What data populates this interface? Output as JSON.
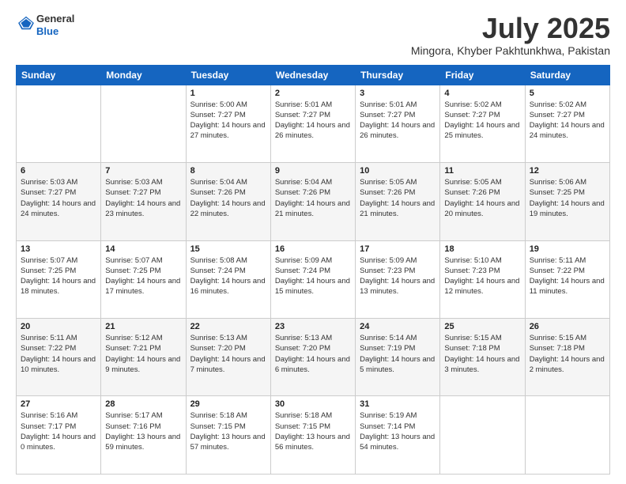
{
  "header": {
    "logo_general": "General",
    "logo_blue": "Blue",
    "month_title": "July 2025",
    "location": "Mingora, Khyber Pakhtunkhwa, Pakistan"
  },
  "weekdays": [
    "Sunday",
    "Monday",
    "Tuesday",
    "Wednesday",
    "Thursday",
    "Friday",
    "Saturday"
  ],
  "weeks": [
    [
      {
        "day": "",
        "sunrise": "",
        "sunset": "",
        "daylight": ""
      },
      {
        "day": "",
        "sunrise": "",
        "sunset": "",
        "daylight": ""
      },
      {
        "day": "1",
        "sunrise": "Sunrise: 5:00 AM",
        "sunset": "Sunset: 7:27 PM",
        "daylight": "Daylight: 14 hours and 27 minutes."
      },
      {
        "day": "2",
        "sunrise": "Sunrise: 5:01 AM",
        "sunset": "Sunset: 7:27 PM",
        "daylight": "Daylight: 14 hours and 26 minutes."
      },
      {
        "day": "3",
        "sunrise": "Sunrise: 5:01 AM",
        "sunset": "Sunset: 7:27 PM",
        "daylight": "Daylight: 14 hours and 26 minutes."
      },
      {
        "day": "4",
        "sunrise": "Sunrise: 5:02 AM",
        "sunset": "Sunset: 7:27 PM",
        "daylight": "Daylight: 14 hours and 25 minutes."
      },
      {
        "day": "5",
        "sunrise": "Sunrise: 5:02 AM",
        "sunset": "Sunset: 7:27 PM",
        "daylight": "Daylight: 14 hours and 24 minutes."
      }
    ],
    [
      {
        "day": "6",
        "sunrise": "Sunrise: 5:03 AM",
        "sunset": "Sunset: 7:27 PM",
        "daylight": "Daylight: 14 hours and 24 minutes."
      },
      {
        "day": "7",
        "sunrise": "Sunrise: 5:03 AM",
        "sunset": "Sunset: 7:27 PM",
        "daylight": "Daylight: 14 hours and 23 minutes."
      },
      {
        "day": "8",
        "sunrise": "Sunrise: 5:04 AM",
        "sunset": "Sunset: 7:26 PM",
        "daylight": "Daylight: 14 hours and 22 minutes."
      },
      {
        "day": "9",
        "sunrise": "Sunrise: 5:04 AM",
        "sunset": "Sunset: 7:26 PM",
        "daylight": "Daylight: 14 hours and 21 minutes."
      },
      {
        "day": "10",
        "sunrise": "Sunrise: 5:05 AM",
        "sunset": "Sunset: 7:26 PM",
        "daylight": "Daylight: 14 hours and 21 minutes."
      },
      {
        "day": "11",
        "sunrise": "Sunrise: 5:05 AM",
        "sunset": "Sunset: 7:26 PM",
        "daylight": "Daylight: 14 hours and 20 minutes."
      },
      {
        "day": "12",
        "sunrise": "Sunrise: 5:06 AM",
        "sunset": "Sunset: 7:25 PM",
        "daylight": "Daylight: 14 hours and 19 minutes."
      }
    ],
    [
      {
        "day": "13",
        "sunrise": "Sunrise: 5:07 AM",
        "sunset": "Sunset: 7:25 PM",
        "daylight": "Daylight: 14 hours and 18 minutes."
      },
      {
        "day": "14",
        "sunrise": "Sunrise: 5:07 AM",
        "sunset": "Sunset: 7:25 PM",
        "daylight": "Daylight: 14 hours and 17 minutes."
      },
      {
        "day": "15",
        "sunrise": "Sunrise: 5:08 AM",
        "sunset": "Sunset: 7:24 PM",
        "daylight": "Daylight: 14 hours and 16 minutes."
      },
      {
        "day": "16",
        "sunrise": "Sunrise: 5:09 AM",
        "sunset": "Sunset: 7:24 PM",
        "daylight": "Daylight: 14 hours and 15 minutes."
      },
      {
        "day": "17",
        "sunrise": "Sunrise: 5:09 AM",
        "sunset": "Sunset: 7:23 PM",
        "daylight": "Daylight: 14 hours and 13 minutes."
      },
      {
        "day": "18",
        "sunrise": "Sunrise: 5:10 AM",
        "sunset": "Sunset: 7:23 PM",
        "daylight": "Daylight: 14 hours and 12 minutes."
      },
      {
        "day": "19",
        "sunrise": "Sunrise: 5:11 AM",
        "sunset": "Sunset: 7:22 PM",
        "daylight": "Daylight: 14 hours and 11 minutes."
      }
    ],
    [
      {
        "day": "20",
        "sunrise": "Sunrise: 5:11 AM",
        "sunset": "Sunset: 7:22 PM",
        "daylight": "Daylight: 14 hours and 10 minutes."
      },
      {
        "day": "21",
        "sunrise": "Sunrise: 5:12 AM",
        "sunset": "Sunset: 7:21 PM",
        "daylight": "Daylight: 14 hours and 9 minutes."
      },
      {
        "day": "22",
        "sunrise": "Sunrise: 5:13 AM",
        "sunset": "Sunset: 7:20 PM",
        "daylight": "Daylight: 14 hours and 7 minutes."
      },
      {
        "day": "23",
        "sunrise": "Sunrise: 5:13 AM",
        "sunset": "Sunset: 7:20 PM",
        "daylight": "Daylight: 14 hours and 6 minutes."
      },
      {
        "day": "24",
        "sunrise": "Sunrise: 5:14 AM",
        "sunset": "Sunset: 7:19 PM",
        "daylight": "Daylight: 14 hours and 5 minutes."
      },
      {
        "day": "25",
        "sunrise": "Sunrise: 5:15 AM",
        "sunset": "Sunset: 7:18 PM",
        "daylight": "Daylight: 14 hours and 3 minutes."
      },
      {
        "day": "26",
        "sunrise": "Sunrise: 5:15 AM",
        "sunset": "Sunset: 7:18 PM",
        "daylight": "Daylight: 14 hours and 2 minutes."
      }
    ],
    [
      {
        "day": "27",
        "sunrise": "Sunrise: 5:16 AM",
        "sunset": "Sunset: 7:17 PM",
        "daylight": "Daylight: 14 hours and 0 minutes."
      },
      {
        "day": "28",
        "sunrise": "Sunrise: 5:17 AM",
        "sunset": "Sunset: 7:16 PM",
        "daylight": "Daylight: 13 hours and 59 minutes."
      },
      {
        "day": "29",
        "sunrise": "Sunrise: 5:18 AM",
        "sunset": "Sunset: 7:15 PM",
        "daylight": "Daylight: 13 hours and 57 minutes."
      },
      {
        "day": "30",
        "sunrise": "Sunrise: 5:18 AM",
        "sunset": "Sunset: 7:15 PM",
        "daylight": "Daylight: 13 hours and 56 minutes."
      },
      {
        "day": "31",
        "sunrise": "Sunrise: 5:19 AM",
        "sunset": "Sunset: 7:14 PM",
        "daylight": "Daylight: 13 hours and 54 minutes."
      },
      {
        "day": "",
        "sunrise": "",
        "sunset": "",
        "daylight": ""
      },
      {
        "day": "",
        "sunrise": "",
        "sunset": "",
        "daylight": ""
      }
    ]
  ]
}
